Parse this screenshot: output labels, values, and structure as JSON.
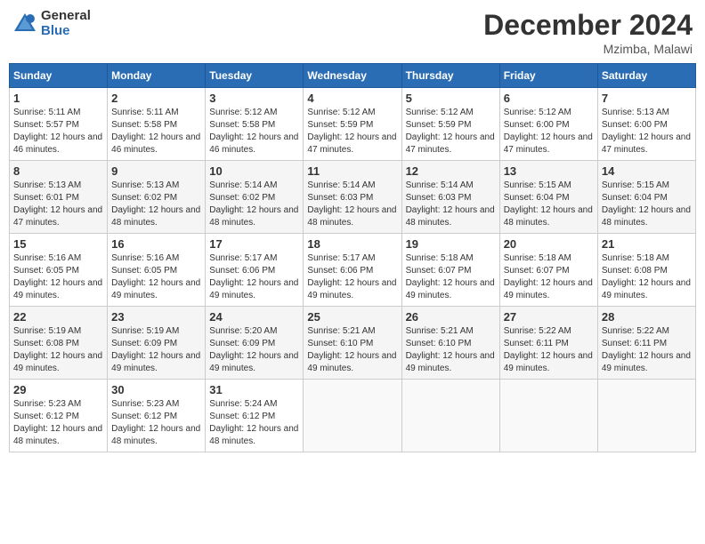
{
  "header": {
    "logo_general": "General",
    "logo_blue": "Blue",
    "month_title": "December 2024",
    "location": "Mzimba, Malawi"
  },
  "days_of_week": [
    "Sunday",
    "Monday",
    "Tuesday",
    "Wednesday",
    "Thursday",
    "Friday",
    "Saturday"
  ],
  "weeks": [
    [
      {
        "day": "1",
        "sunrise": "5:11 AM",
        "sunset": "5:57 PM",
        "daylight": "12 hours and 46 minutes."
      },
      {
        "day": "2",
        "sunrise": "5:11 AM",
        "sunset": "5:58 PM",
        "daylight": "12 hours and 46 minutes."
      },
      {
        "day": "3",
        "sunrise": "5:12 AM",
        "sunset": "5:58 PM",
        "daylight": "12 hours and 46 minutes."
      },
      {
        "day": "4",
        "sunrise": "5:12 AM",
        "sunset": "5:59 PM",
        "daylight": "12 hours and 47 minutes."
      },
      {
        "day": "5",
        "sunrise": "5:12 AM",
        "sunset": "5:59 PM",
        "daylight": "12 hours and 47 minutes."
      },
      {
        "day": "6",
        "sunrise": "5:12 AM",
        "sunset": "6:00 PM",
        "daylight": "12 hours and 47 minutes."
      },
      {
        "day": "7",
        "sunrise": "5:13 AM",
        "sunset": "6:00 PM",
        "daylight": "12 hours and 47 minutes."
      }
    ],
    [
      {
        "day": "8",
        "sunrise": "5:13 AM",
        "sunset": "6:01 PM",
        "daylight": "12 hours and 47 minutes."
      },
      {
        "day": "9",
        "sunrise": "5:13 AM",
        "sunset": "6:02 PM",
        "daylight": "12 hours and 48 minutes."
      },
      {
        "day": "10",
        "sunrise": "5:14 AM",
        "sunset": "6:02 PM",
        "daylight": "12 hours and 48 minutes."
      },
      {
        "day": "11",
        "sunrise": "5:14 AM",
        "sunset": "6:03 PM",
        "daylight": "12 hours and 48 minutes."
      },
      {
        "day": "12",
        "sunrise": "5:14 AM",
        "sunset": "6:03 PM",
        "daylight": "12 hours and 48 minutes."
      },
      {
        "day": "13",
        "sunrise": "5:15 AM",
        "sunset": "6:04 PM",
        "daylight": "12 hours and 48 minutes."
      },
      {
        "day": "14",
        "sunrise": "5:15 AM",
        "sunset": "6:04 PM",
        "daylight": "12 hours and 48 minutes."
      }
    ],
    [
      {
        "day": "15",
        "sunrise": "5:16 AM",
        "sunset": "6:05 PM",
        "daylight": "12 hours and 49 minutes."
      },
      {
        "day": "16",
        "sunrise": "5:16 AM",
        "sunset": "6:05 PM",
        "daylight": "12 hours and 49 minutes."
      },
      {
        "day": "17",
        "sunrise": "5:17 AM",
        "sunset": "6:06 PM",
        "daylight": "12 hours and 49 minutes."
      },
      {
        "day": "18",
        "sunrise": "5:17 AM",
        "sunset": "6:06 PM",
        "daylight": "12 hours and 49 minutes."
      },
      {
        "day": "19",
        "sunrise": "5:18 AM",
        "sunset": "6:07 PM",
        "daylight": "12 hours and 49 minutes."
      },
      {
        "day": "20",
        "sunrise": "5:18 AM",
        "sunset": "6:07 PM",
        "daylight": "12 hours and 49 minutes."
      },
      {
        "day": "21",
        "sunrise": "5:18 AM",
        "sunset": "6:08 PM",
        "daylight": "12 hours and 49 minutes."
      }
    ],
    [
      {
        "day": "22",
        "sunrise": "5:19 AM",
        "sunset": "6:08 PM",
        "daylight": "12 hours and 49 minutes."
      },
      {
        "day": "23",
        "sunrise": "5:19 AM",
        "sunset": "6:09 PM",
        "daylight": "12 hours and 49 minutes."
      },
      {
        "day": "24",
        "sunrise": "5:20 AM",
        "sunset": "6:09 PM",
        "daylight": "12 hours and 49 minutes."
      },
      {
        "day": "25",
        "sunrise": "5:21 AM",
        "sunset": "6:10 PM",
        "daylight": "12 hours and 49 minutes."
      },
      {
        "day": "26",
        "sunrise": "5:21 AM",
        "sunset": "6:10 PM",
        "daylight": "12 hours and 49 minutes."
      },
      {
        "day": "27",
        "sunrise": "5:22 AM",
        "sunset": "6:11 PM",
        "daylight": "12 hours and 49 minutes."
      },
      {
        "day": "28",
        "sunrise": "5:22 AM",
        "sunset": "6:11 PM",
        "daylight": "12 hours and 49 minutes."
      }
    ],
    [
      {
        "day": "29",
        "sunrise": "5:23 AM",
        "sunset": "6:12 PM",
        "daylight": "12 hours and 48 minutes."
      },
      {
        "day": "30",
        "sunrise": "5:23 AM",
        "sunset": "6:12 PM",
        "daylight": "12 hours and 48 minutes."
      },
      {
        "day": "31",
        "sunrise": "5:24 AM",
        "sunset": "6:12 PM",
        "daylight": "12 hours and 48 minutes."
      },
      null,
      null,
      null,
      null
    ]
  ]
}
